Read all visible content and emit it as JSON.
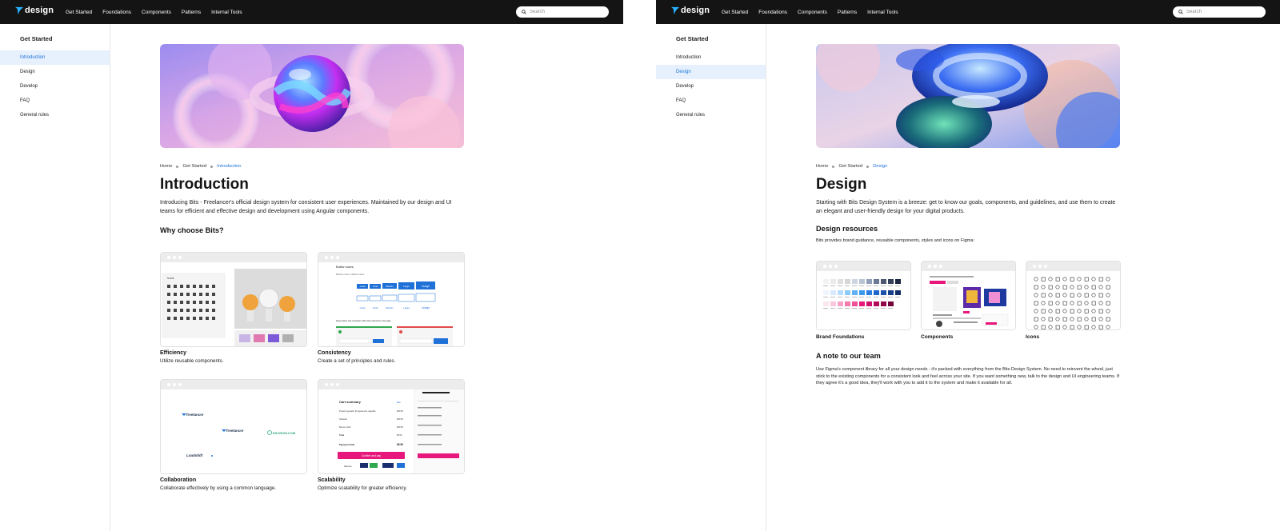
{
  "nav": {
    "logo_text": "design",
    "items": [
      "Get Started",
      "Foundations",
      "Components",
      "Patterns",
      "Internal Tools"
    ],
    "search_placeholder": "Search"
  },
  "left_page": {
    "sidebar": {
      "heading": "Get Started",
      "items": [
        {
          "label": "Introduction",
          "active": true
        },
        {
          "label": "Design",
          "active": false
        },
        {
          "label": "Develop",
          "active": false
        },
        {
          "label": "FAQ",
          "active": false
        },
        {
          "label": "General rules",
          "active": false
        }
      ]
    },
    "breadcrumb": [
      "Home",
      "Get Started",
      "Introduction"
    ],
    "title": "Introduction",
    "intro": "Introducing Bits - Freelancer's official design system for consistent user experiences. Maintained by our design and UI teams for efficient and effective design and development using Angular components.",
    "section_title": "Why choose Bits?",
    "cards": [
      {
        "title": "Efficiency",
        "desc": "Utilize reusable components."
      },
      {
        "title": "Consistency",
        "desc": "Create a set of principles and rules."
      },
      {
        "title": "Collaboration",
        "desc": "Collaborate effectively by using a common language."
      },
      {
        "title": "Scalability",
        "desc": "Optimize scalability for greater efficiency."
      }
    ],
    "card_mockups": {
      "icons_label": "Icons",
      "button_sizes_title": "Button sizes",
      "button_sizes_sub": "Buttons come in different sizes",
      "button_labels": [
        "xsmall",
        "Small",
        "Medium",
        "Large",
        "xLarge"
      ],
      "consistency_note": "Keep button size consistent with other elements in the page",
      "cart": {
        "title": "Cart summary",
        "edit": "Edit",
        "rows": [
          {
            "label": "Project upgrade: IP agreement upgrade",
            "value": "$20.50"
          },
          {
            "label": "Subtotal",
            "value": "$20.50"
          },
          {
            "label": "Bonus credit",
            "value": "$20.50"
          },
          {
            "label": "Total",
            "value": "$5.00"
          }
        ],
        "payment_label": "Payment Total",
        "payment_value": "$5.50",
        "button": "Confirm and pay",
        "secure": "Secure"
      },
      "brands": {
        "freelancer": "freelancer",
        "escrow": "ESCROW.COM",
        "loadshift": "Loadshift"
      }
    }
  },
  "right_page": {
    "sidebar": {
      "heading": "Get Started",
      "items": [
        {
          "label": "Introduction",
          "active": false
        },
        {
          "label": "Design",
          "active": true
        },
        {
          "label": "Develop",
          "active": false
        },
        {
          "label": "FAQ",
          "active": false
        },
        {
          "label": "General rules",
          "active": false
        }
      ]
    },
    "breadcrumb": [
      "Home",
      "Get Started",
      "Design"
    ],
    "title": "Design",
    "intro": "Starting with Bits Design System is a breeze: get to know our goals, components, and guidelines, and use them to create an elegant and user-friendly design for your digital products.",
    "resources_title": "Design resources",
    "resources_text": "Bits provides brand guidance, reusable components, styles and icons on Figma:",
    "resource_cards": [
      {
        "title": "Brand Foundations"
      },
      {
        "title": "Components"
      },
      {
        "title": "Icons"
      }
    ],
    "note_title": "A note to our team",
    "note_text": "Use Figma's component library for all your design needs - it's packed with everything from the Bits Design System. No need to reinvent the wheel, just stick to the existing components for a consistent look and feel across your site. If you want something new, talk to the design and UI engineering teams. If they agree it's a good idea, they'll work with you to add it to the system and make it available for all."
  },
  "colors": {
    "navbar": "#141414",
    "accent_blue": "#1f71d8",
    "sidebar_active_bg": "#e6f1fd",
    "primary_button": "#1f71d8",
    "pink_button": "#e8177c"
  }
}
